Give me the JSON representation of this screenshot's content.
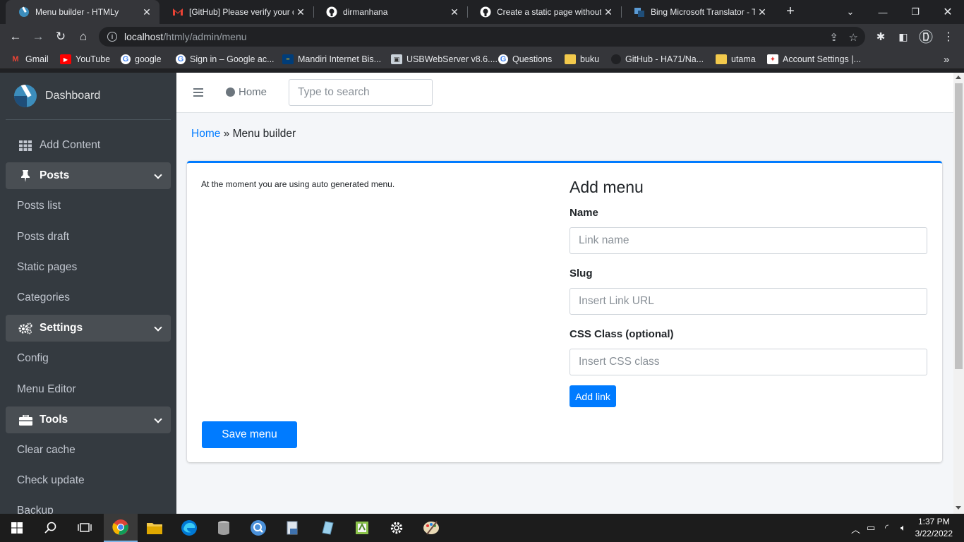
{
  "browser": {
    "tabs": [
      {
        "title": "Menu builder - HTMLy",
        "active": true
      },
      {
        "title": "[GitHub] Please verify your de",
        "active": false
      },
      {
        "title": "dirmanhana",
        "active": false
      },
      {
        "title": "Create a static page without",
        "active": false
      },
      {
        "title": "Bing Microsoft Translator - Te",
        "active": false
      }
    ],
    "url_host": "localhost",
    "url_path": "/htmly/admin/menu",
    "bookmarks": [
      "Gmail",
      "YouTube",
      "google",
      "Sign in – Google ac...",
      "Mandiri Internet Bis...",
      "USBWebServer v8.6....",
      "Questions",
      "buku",
      "GitHub - HA71/Na...",
      "utama",
      "Account Settings |..."
    ],
    "bookmarks_overflow": "»"
  },
  "sidebar": {
    "brand": "Dashboard",
    "add_content": "Add Content",
    "groups": [
      {
        "label": "Posts",
        "items": [
          "Posts list",
          "Posts draft",
          "Static pages",
          "Categories"
        ]
      },
      {
        "label": "Settings",
        "items": [
          "Config",
          "Menu Editor"
        ]
      },
      {
        "label": "Tools",
        "items": [
          "Clear cache",
          "Check update",
          "Backup"
        ]
      }
    ]
  },
  "topnav": {
    "home_label": "Home",
    "search_placeholder": "Type to search"
  },
  "breadcrumb": {
    "home": "Home",
    "separator": " » ",
    "current": "Menu builder"
  },
  "main": {
    "notice": "At the moment you are using auto generated menu.",
    "save_button": "Save menu",
    "form": {
      "title": "Add menu",
      "name_label": "Name",
      "name_placeholder": "Link name",
      "slug_label": "Slug",
      "slug_placeholder": "Insert Link URL",
      "css_label": "CSS Class (optional)",
      "css_placeholder": "Insert CSS class",
      "add_button": "Add link"
    }
  },
  "taskbar": {
    "time": "1:37 PM",
    "date": "3/22/2022"
  },
  "colors": {
    "primary": "#007bff",
    "sidebar_bg": "#343a40",
    "sidebar_active": "#494e53",
    "browser_dark": "#202124",
    "browser_toolbar": "#35363a"
  }
}
